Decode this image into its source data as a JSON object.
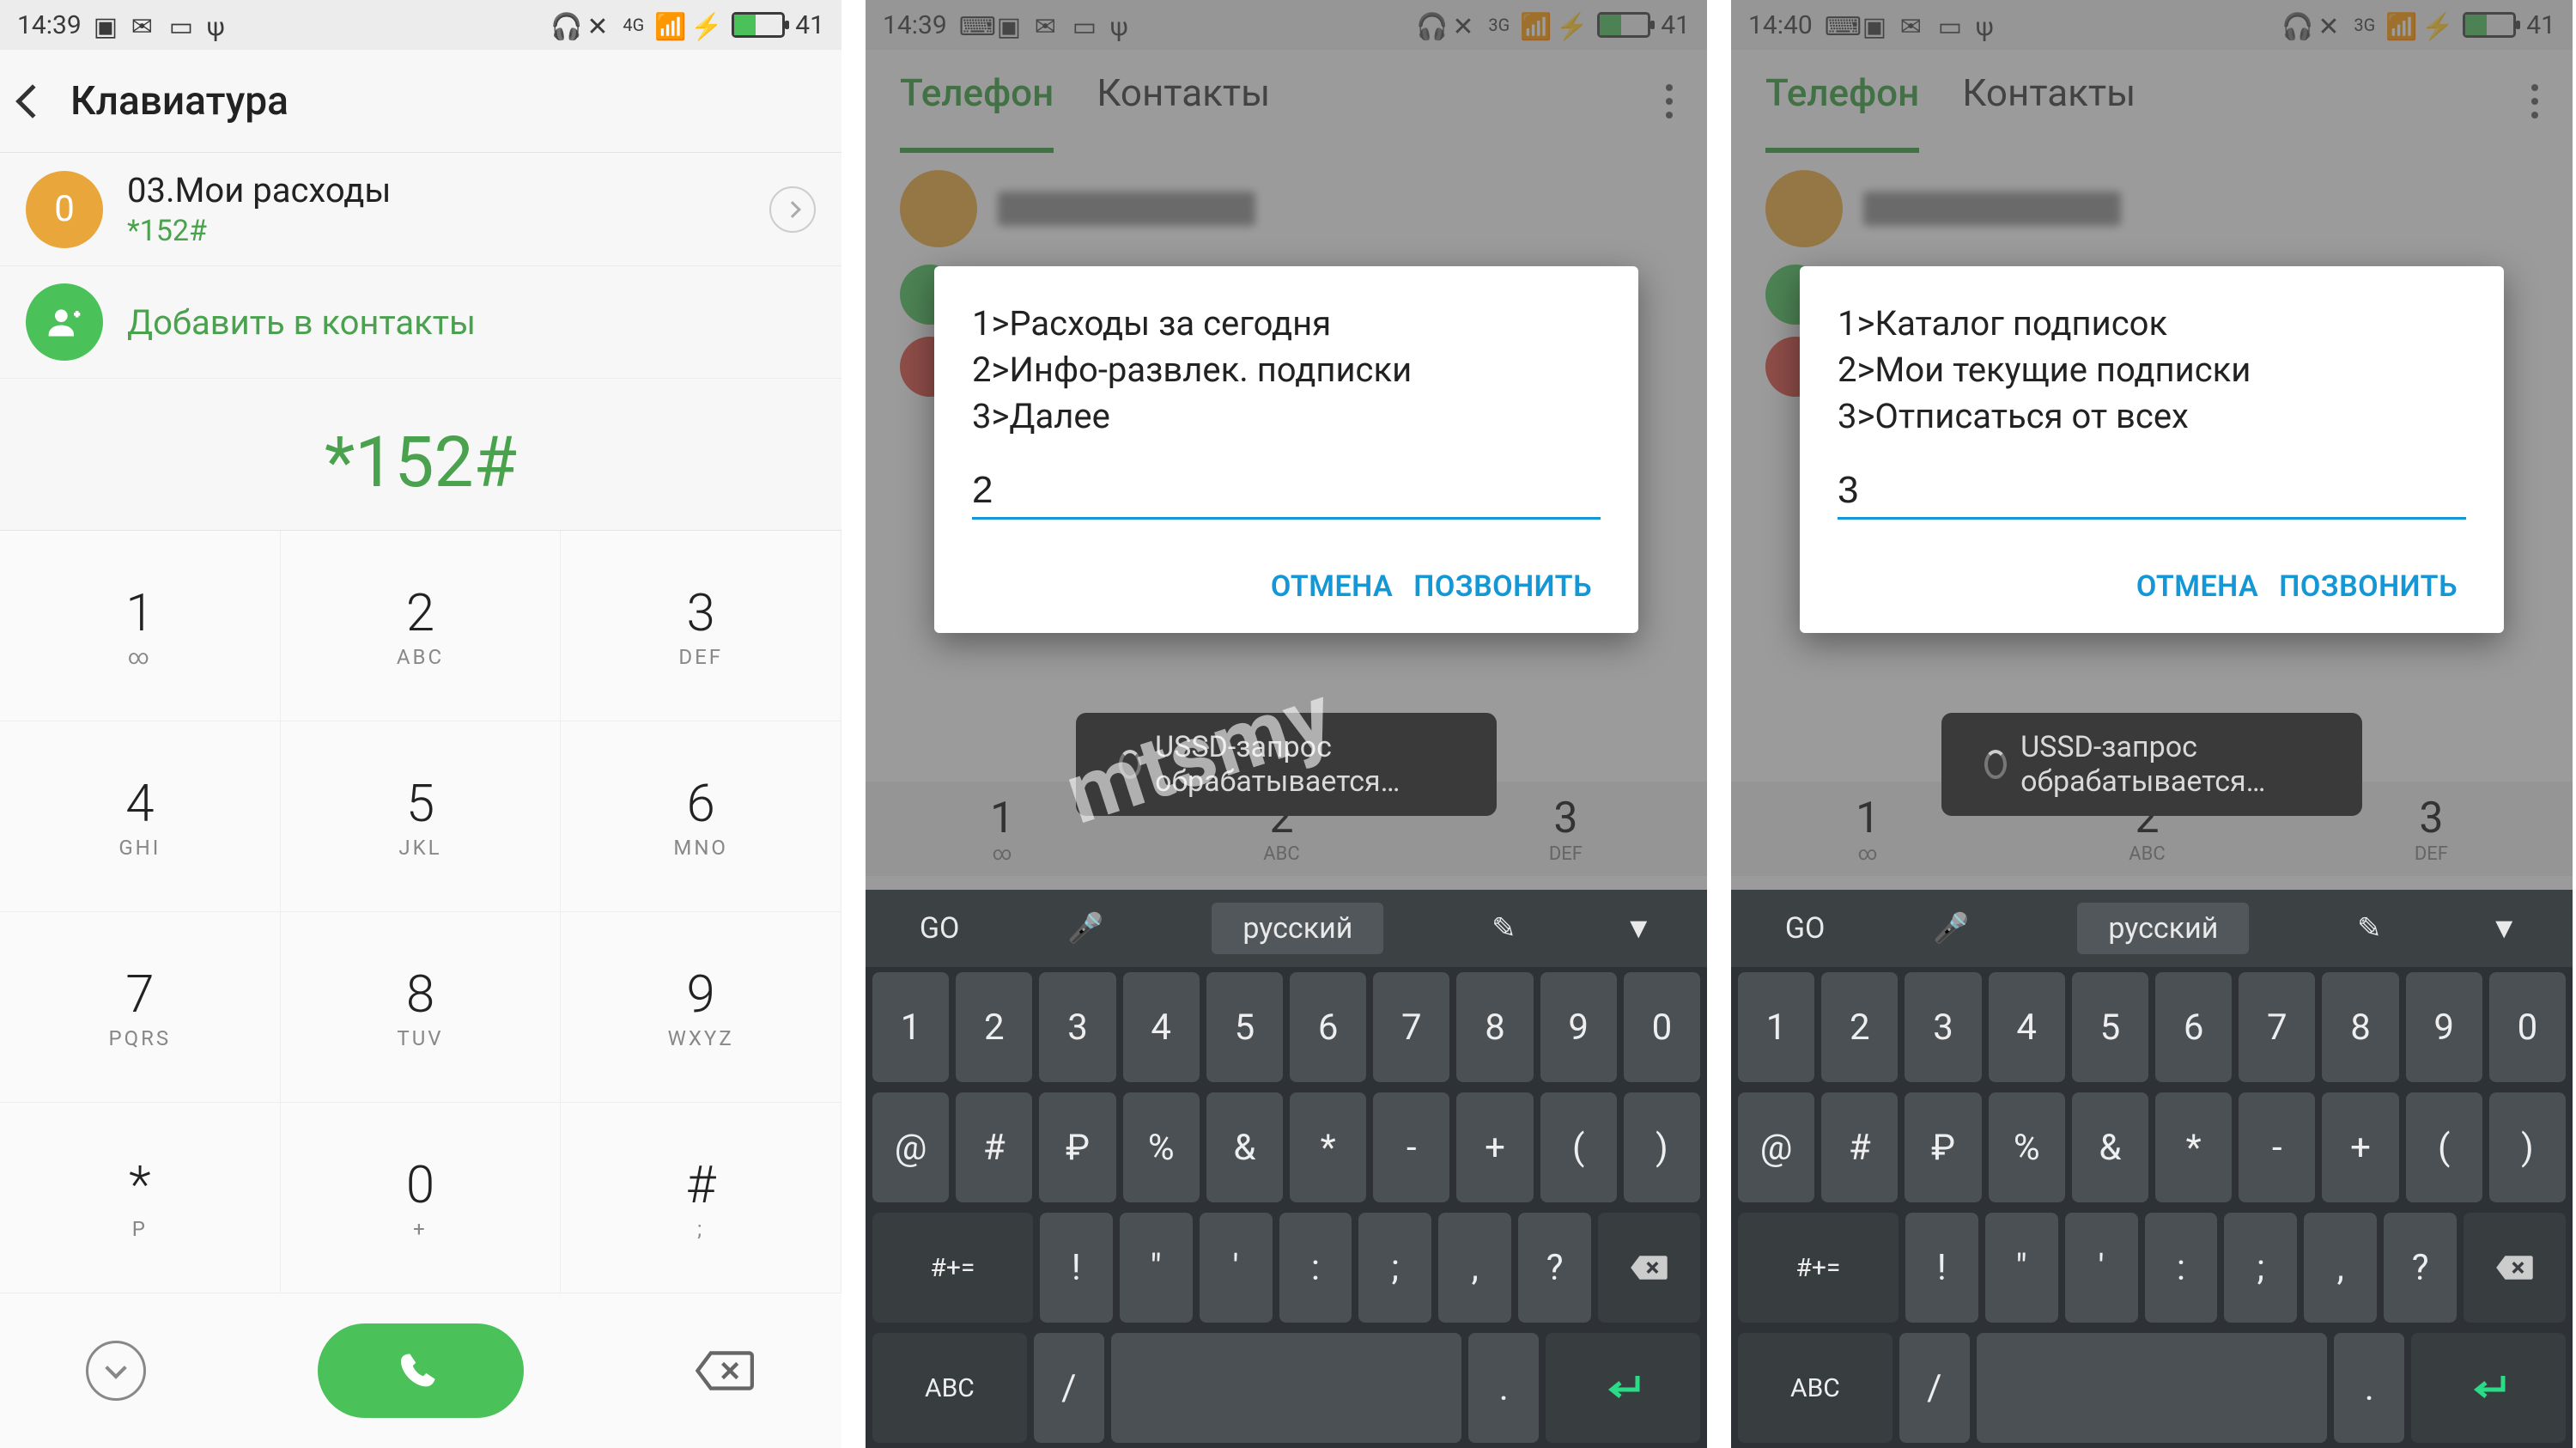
{
  "status": {
    "time1": "14:39",
    "time2": "14:39",
    "time3": "14:40",
    "battery": "41",
    "net": "4G"
  },
  "screen1": {
    "header": "Клавиатура",
    "suggestion_name": "03.Мои расходы",
    "suggestion_code": "*152#",
    "add_contact": "Добавить в контакты",
    "dialed": "*152#",
    "keys": [
      {
        "n": "1",
        "s": "∞"
      },
      {
        "n": "2",
        "s": "ABC"
      },
      {
        "n": "3",
        "s": "DEF"
      },
      {
        "n": "4",
        "s": "GHI"
      },
      {
        "n": "5",
        "s": "JKL"
      },
      {
        "n": "6",
        "s": "MNO"
      },
      {
        "n": "7",
        "s": "PQRS"
      },
      {
        "n": "8",
        "s": "TUV"
      },
      {
        "n": "9",
        "s": "WXYZ"
      },
      {
        "n": "*",
        "s": "P"
      },
      {
        "n": "0",
        "s": "+"
      },
      {
        "n": "#",
        "s": ";"
      }
    ]
  },
  "tabs": {
    "phone": "Телефон",
    "contacts": "Контакты"
  },
  "dialog_btn_cancel": "ОТМЕНА",
  "dialog_btn_send": "ПОЗВОНИТЬ",
  "toast": "USSD-запрос обрабатывается…",
  "greykeys": [
    {
      "n": "1",
      "s": "∞"
    },
    {
      "n": "2",
      "s": "ABC"
    },
    {
      "n": "3",
      "s": "DEF"
    }
  ],
  "dialog2": {
    "body": "1>Расходы за сегодня\n2>Инфо-развлек. подписки\n3>Далее",
    "input": "2"
  },
  "dialog3": {
    "body": "1>Каталог подписок\n2>Мои текущие подписки\n3>Отписаться от всех",
    "input": "3"
  },
  "kb": {
    "lang": "русский",
    "row1": [
      "1",
      "2",
      "3",
      "4",
      "5",
      "6",
      "7",
      "8",
      "9",
      "0"
    ],
    "row2": [
      "@",
      "#",
      "₽",
      "%",
      "&",
      "*",
      "-",
      "+",
      "(",
      ")"
    ],
    "row3_left": "#+=",
    "row3": [
      "!",
      "\"",
      "'",
      ":",
      ";",
      ",",
      "?"
    ],
    "row4_left": "ABC",
    "row4_mid": "/",
    "row4_dot": "."
  },
  "watermark": "mtsmy"
}
